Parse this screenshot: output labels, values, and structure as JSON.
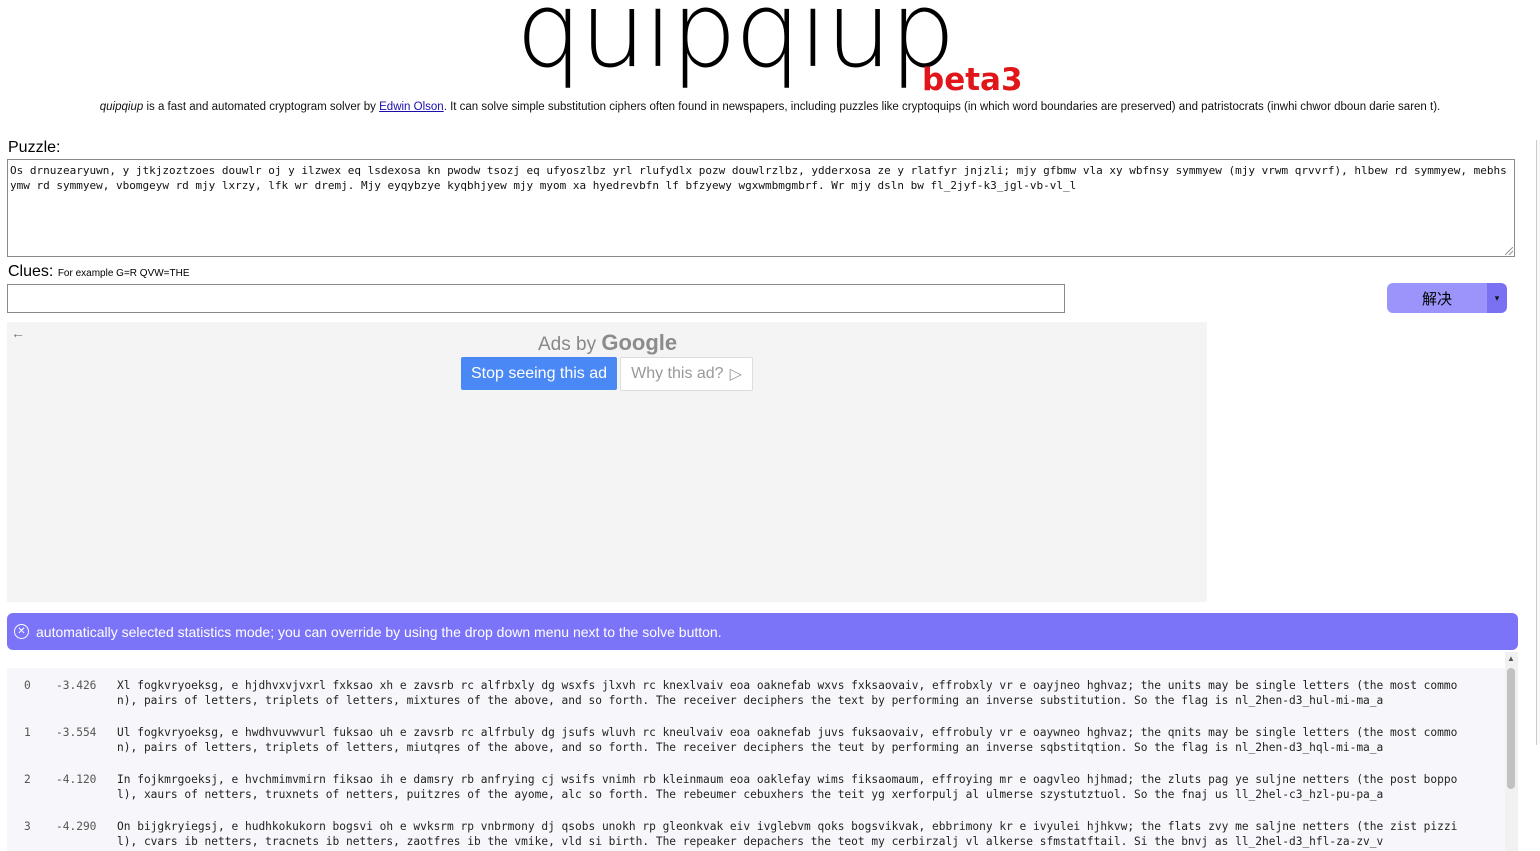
{
  "header": {
    "logo": "quipqiup",
    "beta": "beta3",
    "tagline_brand": "quipqiup",
    "tagline_pre": " is a fast and automated cryptogram solver by ",
    "tagline_link": "Edwin Olson",
    "tagline_post": ". It can solve simple substitution ciphers often found in newspapers, including puzzles like cryptoquips (in which word boundaries are preserved) and patristocrats (inwhi chwor dboun darie saren t)."
  },
  "puzzle": {
    "label": "Puzzle:",
    "value": "Os drnuzearyuwn, y jtkjzoztzoes douwlr oj y ilzwex eq lsdexosa kn pwodw tsozj eq ufyoszlbz yrl rlufydlx pozw douwlrzlbz, ydderxosa ze y rlatfyr jnjzli; mjy gfbmw vla xy wbfnsy symmyew (mjy vrwm qrvvrf), hlbew rd symmyew, mebhsymw rd symmyew, vbomgeyw rd mjy lxrzy, lfk wr dremj. Mjy eyqybzye kyqbhjyew mjy myom xa hyedrevbfn lf bfzyewy wgxwmbmgmbrf. Wr mjy dsln bw fl_2jyf-k3_jgl-vb-vl_l"
  },
  "clues": {
    "label": "Clues:",
    "hint": "For example G=R QVW=THE",
    "value": ""
  },
  "solve": {
    "label": "解决",
    "dropdown_icon": "▾"
  },
  "ad": {
    "back_icon": "←",
    "ads_by": "Ads by",
    "google": "Google",
    "stop_label": "Stop seeing this ad",
    "why_label": "Why this ad?",
    "why_icon": "▷"
  },
  "banner": {
    "close_icon": "✕",
    "message": "automatically selected statistics mode; you can override by using the drop down menu next to the solve button."
  },
  "results": [
    {
      "index": "0",
      "score": "-3.426",
      "text": "Xl fogkvryoeksg, e hjdhvxvjvxrl fxksao xh e zavsrb rc alfrbxly dg wsxfs jlxvh rc knexlvaiv eoa oaknefab wxvs fxksaovaiv, effrobxly vr e oayjneo hghvaz; the units may be single letters (the most common), pairs of letters, triplets of letters, mixtures of the above, and so forth. The receiver deciphers the text by performing an inverse substitution. So the flag is nl_2hen-d3_hul-mi-ma_a"
    },
    {
      "index": "1",
      "score": "-3.554",
      "text": "Ul fogkvryoeksg, e hwdhvuvwvurl fuksao uh e zavsrb rc alfrbuly dg jsufs wluvh rc kneulvaiv eoa oaknefab juvs fuksaovaiv, effrobuly vr e oaywneo hghvaz; the qnits may be single letters (the most common), pairs of letters, triplets of letters, miutqres of the above, and so forth. The receiver deciphers the teut by performing an inverse sqbstitqtion. So the flag is nl_2hen-d3_hql-mi-ma_a"
    },
    {
      "index": "2",
      "score": "-4.120",
      "text": "In fojkmrgoeksj, e hvchmimvmirn fiksao ih e damsry rb anfrying cj wsifs vnimh rb kleinmaum eoa oaklefay wims fiksaomaum, effroying mr e oagvleo hjhmad; the zluts pag ye suljne netters (the post boppol), xaurs of netters, truxnets of netters, puitzres of the ayome, alc so forth. The rebeumer cebuxhers the teit yg xerforpulj al ulmerse szystutztuol. So the fnaj us ll_2hel-c3_hzl-pu-pa_a"
    },
    {
      "index": "3",
      "score": "-4.290",
      "text": "On bijgkryiegsj, e hudhkokukorn bogsvi oh e wvksrm rp vnbrmony dj qsobs unokh rp gleonkvak eiv ivglebvm qoks bogsvikvak, ebbrimony kr e ivyulei hjhkvw; the flats zvy me saljne netters (the zist pizzil), cvars ib netters, tracnets ib netters, zaotfres ib the vmike, vld si birth. The repeaker depachers the teot my cerbirzalj vl alkerse sfmstatftail. Si the bnvj as ll_2hel-d3_hfl-za-zv_v"
    }
  ]
}
